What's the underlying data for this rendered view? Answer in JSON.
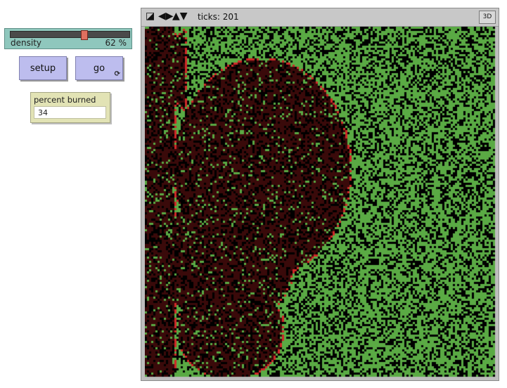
{
  "slider": {
    "label": "density",
    "value_text": "62 %",
    "value": 62,
    "min": 0,
    "max": 100
  },
  "buttons": {
    "setup_label": "setup",
    "go_label": "go",
    "go_forever_icon": "forever-loop-icon"
  },
  "monitor": {
    "label": "percent burned",
    "value": "34"
  },
  "view": {
    "ticks_label": "ticks: 201",
    "three_d_label": "3D",
    "colors": {
      "tree": "#5aaa44",
      "empty": "#000000",
      "burnt": "#3a0a0a",
      "fire": "#d02828"
    },
    "icons": [
      "zoom-icon",
      "left-right-icon",
      "up-down-icon"
    ]
  }
}
